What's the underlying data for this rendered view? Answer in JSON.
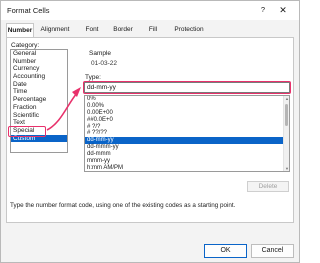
{
  "window": {
    "title": "Format Cells",
    "help_glyph": "?",
    "close_glyph": "✕"
  },
  "tabs": [
    {
      "label": "Number"
    },
    {
      "label": "Alignment"
    },
    {
      "label": "Font"
    },
    {
      "label": "Border"
    },
    {
      "label": "Fill"
    },
    {
      "label": "Protection"
    }
  ],
  "category": {
    "label": "Category:",
    "items": [
      "General",
      "Number",
      "Currency",
      "Accounting",
      "Date",
      "Time",
      "Percentage",
      "Fraction",
      "Scientific",
      "Text",
      "Special",
      "Custom"
    ],
    "selected": "Custom"
  },
  "sample": {
    "label": "Sample",
    "value": "01-03-22"
  },
  "type": {
    "label": "Type:",
    "input_value": "dd-mm-yy",
    "items": [
      "0%",
      "0.00%",
      "0.00E+00",
      "##0.0E+0",
      "# ?/?",
      "# ??/??",
      "dd-mm-yy",
      "dd-mmm-yy",
      "dd-mmm",
      "mmm-yy",
      "h:mm AM/PM"
    ],
    "selected": "dd-mm-yy"
  },
  "buttons": {
    "delete": "Delete",
    "ok": "OK",
    "cancel": "Cancel"
  },
  "hint": "Type the number format code, using one of the existing codes as a starting point.",
  "colors": {
    "accent": "#0a64c8",
    "annotation": "#e8316b"
  }
}
